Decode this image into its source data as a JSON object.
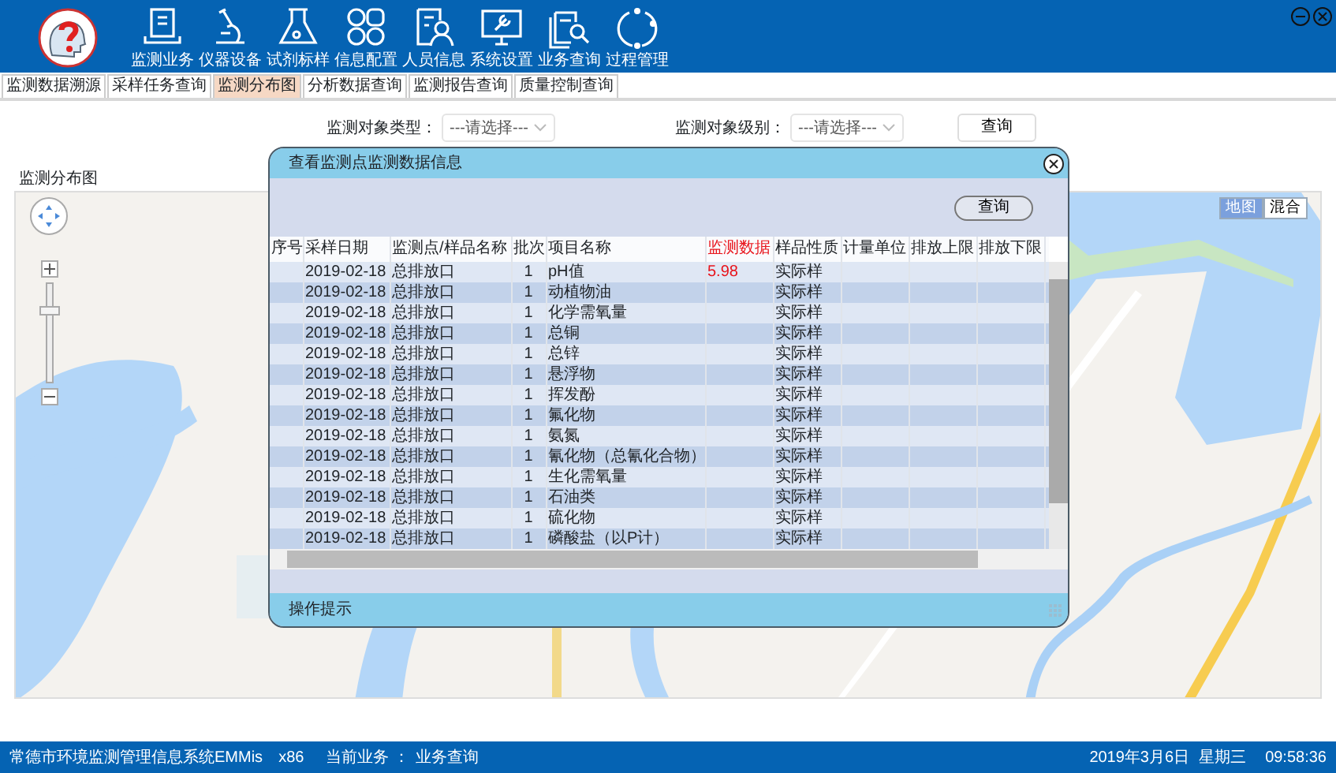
{
  "toolbar": [
    {
      "label": "监测业务"
    },
    {
      "label": "仪器设备"
    },
    {
      "label": "试剂标样"
    },
    {
      "label": "信息配置"
    },
    {
      "label": "人员信息"
    },
    {
      "label": "系统设置"
    },
    {
      "label": "业务查询"
    },
    {
      "label": "过程管理"
    }
  ],
  "tabs": [
    {
      "label": "监测数据溯源",
      "selected": false
    },
    {
      "label": "采样任务查询",
      "selected": false
    },
    {
      "label": "监测分布图",
      "selected": true
    },
    {
      "label": "分析数据查询",
      "selected": false
    },
    {
      "label": "监测报告查询",
      "selected": false
    },
    {
      "label": "质量控制查询",
      "selected": false
    }
  ],
  "filters": [
    {
      "label": "监测对象类型：",
      "value": "---请选择---"
    },
    {
      "label": "监测对象级别：",
      "value": "---请选择---"
    }
  ],
  "search_button": "查询",
  "map_panel": {
    "title": "监测分布图",
    "zoom": {
      "level": 0.75
    },
    "map_types": [
      {
        "label": "地图",
        "selected": true
      },
      {
        "label": "混合",
        "selected": false
      }
    ]
  },
  "dialog": {
    "title": "查看监测点监测数据信息",
    "query_button": "查询",
    "columns": [
      {
        "label": "序号",
        "highlighted": false
      },
      {
        "label": "采样日期",
        "highlighted": false
      },
      {
        "label": "监测点/样品名称",
        "highlighted": false
      },
      {
        "label": "批次",
        "highlighted": false
      },
      {
        "label": "项目名称",
        "highlighted": false
      },
      {
        "label": "监测数据",
        "highlighted": true
      },
      {
        "label": "样品性质",
        "highlighted": false
      },
      {
        "label": "计量单位",
        "highlighted": false
      },
      {
        "label": "排放上限",
        "highlighted": false
      },
      {
        "label": "排放下限",
        "highlighted": false
      }
    ],
    "rows": [
      {
        "date": "2019-02-18",
        "site": "总排放口",
        "batch": "1",
        "item": "pH值",
        "value": "5.98",
        "nature": "实际样"
      },
      {
        "date": "2019-02-18",
        "site": "总排放口",
        "batch": "1",
        "item": "动植物油",
        "nature": "实际样"
      },
      {
        "date": "2019-02-18",
        "site": "总排放口",
        "batch": "1",
        "item": "化学需氧量",
        "nature": "实际样"
      },
      {
        "date": "2019-02-18",
        "site": "总排放口",
        "batch": "1",
        "item": "总铜",
        "nature": "实际样"
      },
      {
        "date": "2019-02-18",
        "site": "总排放口",
        "batch": "1",
        "item": "总锌",
        "nature": "实际样"
      },
      {
        "date": "2019-02-18",
        "site": "总排放口",
        "batch": "1",
        "item": "悬浮物",
        "nature": "实际样"
      },
      {
        "date": "2019-02-18",
        "site": "总排放口",
        "batch": "1",
        "item": "挥发酚",
        "nature": "实际样"
      },
      {
        "date": "2019-02-18",
        "site": "总排放口",
        "batch": "1",
        "item": "氟化物",
        "nature": "实际样"
      },
      {
        "date": "2019-02-18",
        "site": "总排放口",
        "batch": "1",
        "item": "氨氮",
        "nature": "实际样"
      },
      {
        "date": "2019-02-18",
        "site": "总排放口",
        "batch": "1",
        "item": "氰化物（总氰化合物）",
        "nature": "实际样"
      },
      {
        "date": "2019-02-18",
        "site": "总排放口",
        "batch": "1",
        "item": "生化需氧量",
        "nature": "实际样"
      },
      {
        "date": "2019-02-18",
        "site": "总排放口",
        "batch": "1",
        "item": "石油类",
        "nature": "实际样"
      },
      {
        "date": "2019-02-18",
        "site": "总排放口",
        "batch": "1",
        "item": "硫化物",
        "nature": "实际样"
      },
      {
        "date": "2019-02-18",
        "site": "总排放口",
        "batch": "1",
        "item": "磷酸盐（以P计）",
        "nature": "实际样"
      }
    ],
    "footer": "操作提示"
  },
  "status_bar": {
    "system": "常德市环境监测管理信息系统EMMis",
    "arch": "x86",
    "current_label": "当前业务 ：",
    "current": "业务查询",
    "date": "2019年3月6日",
    "weekday": "星期三",
    "time": "09:58:36"
  }
}
